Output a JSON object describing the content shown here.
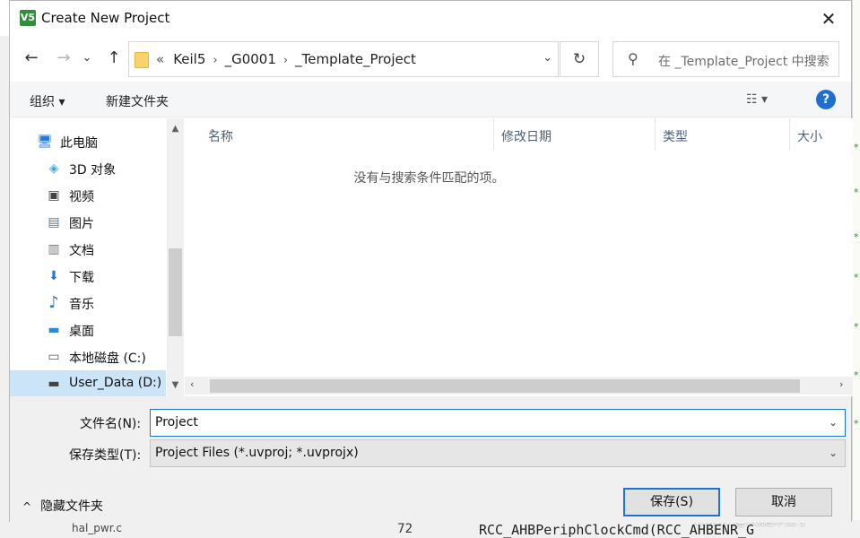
{
  "window": {
    "title": "Create New Project",
    "icon_text": "V5",
    "close_glyph": "✕"
  },
  "nav": {
    "back_glyph": "←",
    "forward_glyph": "→",
    "recent_glyph": "⌄",
    "up_glyph": "↑"
  },
  "address": {
    "lead": "«",
    "crumbs": [
      "Keil5",
      "_G0001",
      "_Template_Project"
    ],
    "separator": "›",
    "dropdown_glyph": "⌄",
    "refresh_glyph": "↻"
  },
  "search": {
    "placeholder": "在 _Template_Project 中搜索",
    "icon_glyph": "⚲"
  },
  "toolbar": {
    "organize": "组织 ▾",
    "new_folder": "新建文件夹",
    "view_glyph": "☷ ▾",
    "help_glyph": "?"
  },
  "sidebar": {
    "items": [
      {
        "label": "此电脑",
        "icon": "computer-icon",
        "glyph": "🖥",
        "color": "#2b78d4"
      },
      {
        "label": "3D 对象",
        "icon": "cube-icon",
        "glyph": "◈",
        "color": "#3fa9e0"
      },
      {
        "label": "视频",
        "icon": "video-icon",
        "glyph": "▣",
        "color": "#444444"
      },
      {
        "label": "图片",
        "icon": "picture-icon",
        "glyph": "▤",
        "color": "#3d7bb8"
      },
      {
        "label": "文档",
        "icon": "document-icon",
        "glyph": "▥",
        "color": "#777777"
      },
      {
        "label": "下载",
        "icon": "download-icon",
        "glyph": "⬇",
        "color": "#2b78d4"
      },
      {
        "label": "音乐",
        "icon": "music-icon",
        "glyph": "♪",
        "color": "#2b78d4"
      },
      {
        "label": "桌面",
        "icon": "desktop-icon",
        "glyph": "▬",
        "color": "#2b8ad4"
      },
      {
        "label": "本地磁盘 (C:)",
        "icon": "drive-c-icon",
        "glyph": "▭",
        "color": "#555555"
      },
      {
        "label": "User_Data (D:)",
        "icon": "drive-d-icon",
        "glyph": "▬",
        "color": "#444444"
      }
    ],
    "scroll_up": "▲",
    "scroll_down": "▼"
  },
  "filelist": {
    "columns": [
      "名称",
      "修改日期",
      "类型",
      "大小"
    ],
    "sort_glyph": "^",
    "empty_message": "没有与搜索条件匹配的项。",
    "scroll_left": "‹",
    "scroll_right": "›"
  },
  "form": {
    "filename_label": "文件名(N):",
    "filename_value": "Project",
    "filetype_label": "保存类型(T):",
    "filetype_value": "Project Files (*.uvproj; *.uvprojx)",
    "dropdown_glyph": "⌄"
  },
  "footer": {
    "hide_folders": "隐藏文件夹",
    "hide_glyph": "^",
    "save": "保存(S)",
    "cancel": "取消"
  },
  "background": {
    "tree_item": "hal_pwr.c",
    "line_number": "72",
    "code_line": "RCC_AHBPeriphClockCmd(RCC_AHBENR_G",
    "watermark": "CSDN @火腿炸王子",
    "marks": [
      "*",
      "*",
      "*",
      "*",
      "*",
      "*",
      "*"
    ]
  },
  "colors": {
    "accent": "#1a73d9",
    "selected_bg": "#cce4f7",
    "help_bg": "#1f6fd1"
  }
}
